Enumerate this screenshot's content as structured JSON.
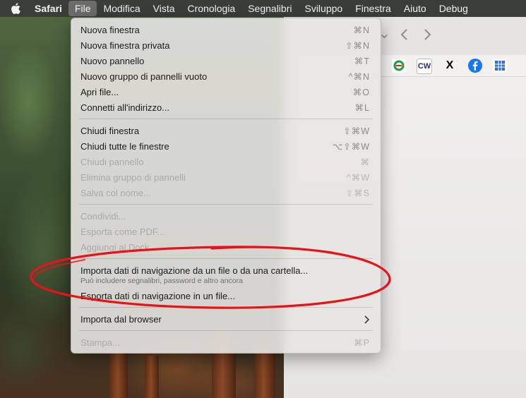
{
  "menubar": {
    "apple_icon": "apple-icon",
    "items": [
      "Safari",
      "File",
      "Modifica",
      "Vista",
      "Cronologia",
      "Segnalibri",
      "Sviluppo",
      "Finestra",
      "Aiuto",
      "Debug"
    ],
    "active": "File"
  },
  "safari_toolbar": {
    "back_icon": "chevron-left-icon",
    "forward_icon": "chevron-right-icon",
    "favorites": [
      {
        "icon": "green-swirl-icon",
        "color": "#1f9e3a"
      },
      {
        "text": "CW",
        "color": "#2a2a8a"
      },
      {
        "text": "X",
        "color": "#000000"
      },
      {
        "icon": "facebook-icon",
        "color": "#1877f2"
      },
      {
        "icon": "grid-chart-icon",
        "color": "#3a6ec4"
      }
    ]
  },
  "file_menu": {
    "sections": [
      {
        "items": [
          {
            "label": "Nuova finestra",
            "shortcut": "⌘N",
            "enabled": true
          },
          {
            "label": "Nuova finestra privata",
            "shortcut": "⇧⌘N",
            "enabled": true
          },
          {
            "label": "Nuovo pannello",
            "shortcut": "⌘T",
            "enabled": true
          },
          {
            "label": "Nuovo gruppo di pannelli vuoto",
            "shortcut": "^⌘N",
            "enabled": true
          },
          {
            "label": "Apri file...",
            "shortcut": "⌘O",
            "enabled": true
          },
          {
            "label": "Connetti all'indirizzo...",
            "shortcut": "⌘L",
            "enabled": true
          }
        ]
      },
      {
        "items": [
          {
            "label": "Chiudi finestra",
            "shortcut": "⇧⌘W",
            "enabled": true
          },
          {
            "label": "Chiudi tutte le finestre",
            "shortcut": "⌥⇧⌘W",
            "enabled": true
          },
          {
            "label": "Chiudi pannello",
            "shortcut": "⌘",
            "enabled": false
          },
          {
            "label": "Elimina gruppo di pannelli",
            "shortcut": "^⌘W",
            "enabled": false
          },
          {
            "label": "Salva col nome...",
            "shortcut": "⇧⌘S",
            "enabled": false
          }
        ]
      },
      {
        "items": [
          {
            "label": "Condividi...",
            "shortcut": "",
            "enabled": false
          },
          {
            "label": "Esporta come PDF...",
            "shortcut": "",
            "enabled": false
          },
          {
            "label": "Aggiungi al Dock...",
            "shortcut": "",
            "enabled": false
          }
        ]
      },
      {
        "items": [
          {
            "label": "Importa dati di navigazione da un file o da una cartella...",
            "sublabel": "Può includere segnalibri, password e altro ancora",
            "shortcut": "",
            "enabled": true
          },
          {
            "label": "Esporta dati di navigazione in un file...",
            "shortcut": "",
            "enabled": true
          }
        ]
      },
      {
        "items": [
          {
            "label": "Importa dal browser",
            "shortcut": "",
            "submenu": true,
            "enabled": true
          }
        ]
      },
      {
        "items": [
          {
            "label": "Stampa...",
            "shortcut": "⌘P",
            "enabled": false
          }
        ]
      }
    ]
  },
  "annotation": {
    "color": "#e8121a",
    "shape": "hand-drawn ellipse"
  }
}
